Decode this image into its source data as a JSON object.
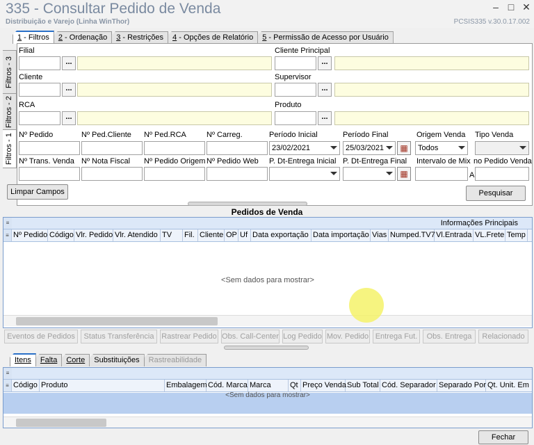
{
  "window": {
    "title": "335 - Consultar Pedido de Venda",
    "subtitle": "Distribuição e Varejo (Linha WinThor)",
    "version": "PCSIS335  v.30.0.17.002",
    "min": "–",
    "max": "□",
    "close": "✕"
  },
  "tabs": [
    {
      "num": "1",
      "label": " - Filtros"
    },
    {
      "num": "2",
      "label": " - Ordenação"
    },
    {
      "num": "3",
      "label": " - Restrições"
    },
    {
      "num": "4",
      "label": " - Opções de Relatório"
    },
    {
      "num": "5",
      "label": " - Permissão de Acesso por Usuário"
    }
  ],
  "vtabs": {
    "f3": "Filtros - 3",
    "f2": "Filtros - 2",
    "f1": "Filtros - 1"
  },
  "filters": {
    "filial": "Filial",
    "cliente_principal": "Cliente Principal",
    "cliente": "Cliente",
    "supervisor": "Supervisor",
    "rca": "RCA",
    "produto": "Produto",
    "dots": "...",
    "num_pedido": "Nº Pedido",
    "num_ped_cliente": "Nº Ped.Cliente",
    "num_ped_rca": "Nº Ped.RCA",
    "num_carreg": "Nº Carreg.",
    "periodo_inicial": "Período Inicial",
    "periodo_inicial_value": "23/02/2021",
    "periodo_final": "Período Final",
    "periodo_final_value": "25/03/2021",
    "origem_venda": "Origem Venda",
    "origem_venda_value": "Todos",
    "tipo_venda": "Tipo Venda",
    "num_trans_venda": "Nº Trans. Venda",
    "num_nota_fiscal": "Nº Nota Fiscal",
    "num_pedido_origem": "Nº Pedido Origem",
    "num_pedido_web": "Nº Pedido Web",
    "pdt_entrega_inicial": "P. Dt-Entrega Inicial",
    "pdt_entrega_final": "P. Dt-Entrega Final",
    "intervalo_mix": "Intervalo de Mix",
    "intervalo_a": "A",
    "no_pedido_venda": "no Pedido Venda"
  },
  "buttons": {
    "limpar": "Limpar Campos",
    "pesquisar": "Pesquisar",
    "fechar": "Fechar"
  },
  "grid1": {
    "title": "Pedidos de  Venda",
    "group": "Informações Principais",
    "columns": [
      "Nº Pedido",
      "Código",
      "Vlr. Pedido",
      "Vlr. Atendido",
      "TV",
      "Fil.",
      "Cliente",
      "OP",
      "Uf",
      "Data exportação",
      "Data importação",
      "Vias",
      "Numped.TV7",
      "Vl.Entrada",
      "VL.Frete",
      "Temp"
    ],
    "empty": "<Sem dados para mostrar>"
  },
  "actions": [
    "Eventos de Pedidos",
    "Status Transferência",
    "Rastrear Pedido",
    "Obs. Call-Center",
    "Log Pedido",
    "Mov. Pedido",
    "Entrega Fut.",
    "Obs. Entrega",
    "Relacionado"
  ],
  "bottom_tabs": [
    "Itens",
    "Falta",
    "Corte",
    "Substituições",
    "Rastreabilidade"
  ],
  "grid2": {
    "columns": [
      "Código",
      "Produto",
      "Embalagem",
      "Cód. Marca",
      "Marca",
      "Qt",
      "Preço Venda",
      "Sub Total",
      "Cód. Separador",
      "Separado Por",
      "Qt. Unit. Em"
    ],
    "empty": "<Sem dados para mostrar>"
  }
}
